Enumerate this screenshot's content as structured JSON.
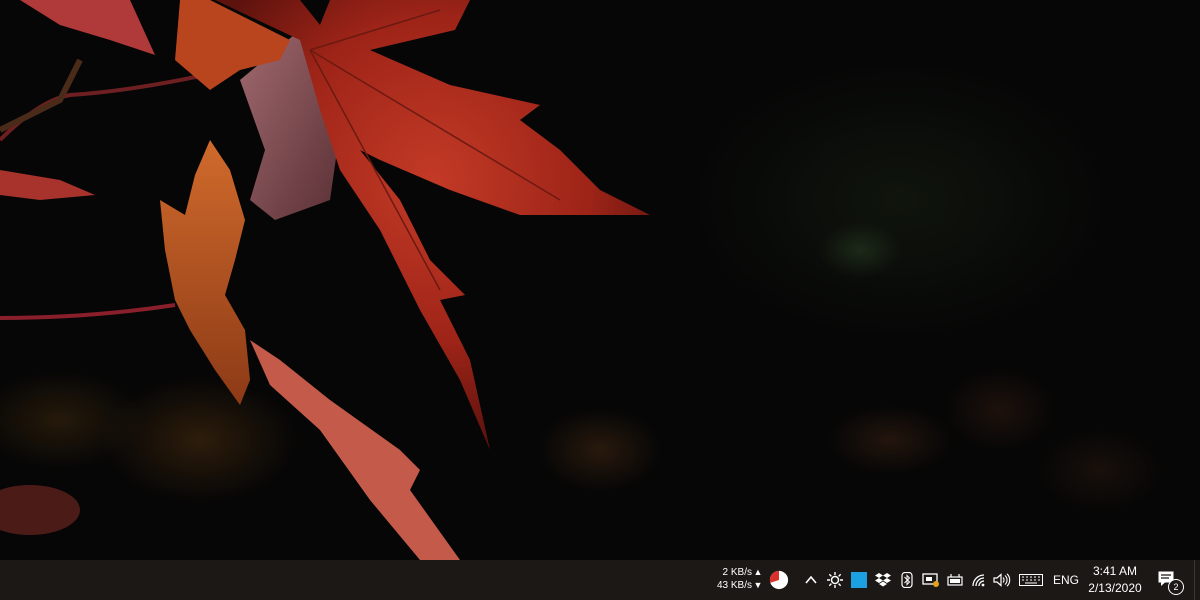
{
  "taskbar": {
    "net_upload": "2 KB/s",
    "net_download": "43 KB/s",
    "language": "ENG",
    "time": "3:41 AM",
    "date": "2/13/2020",
    "notification_count": "2",
    "icons": [
      "pie-chart-icon",
      "chevron-up-icon",
      "brightness-icon",
      "app-icon",
      "dropbox-icon",
      "bluetooth-icon",
      "display-icon",
      "battery-icon",
      "wifi-icon",
      "volume-icon",
      "keyboard-icon",
      "notification-icon"
    ]
  },
  "colors": {
    "taskbar": "#1b1816",
    "accent": "#1ba1e2",
    "leaf": "#b8321f"
  }
}
